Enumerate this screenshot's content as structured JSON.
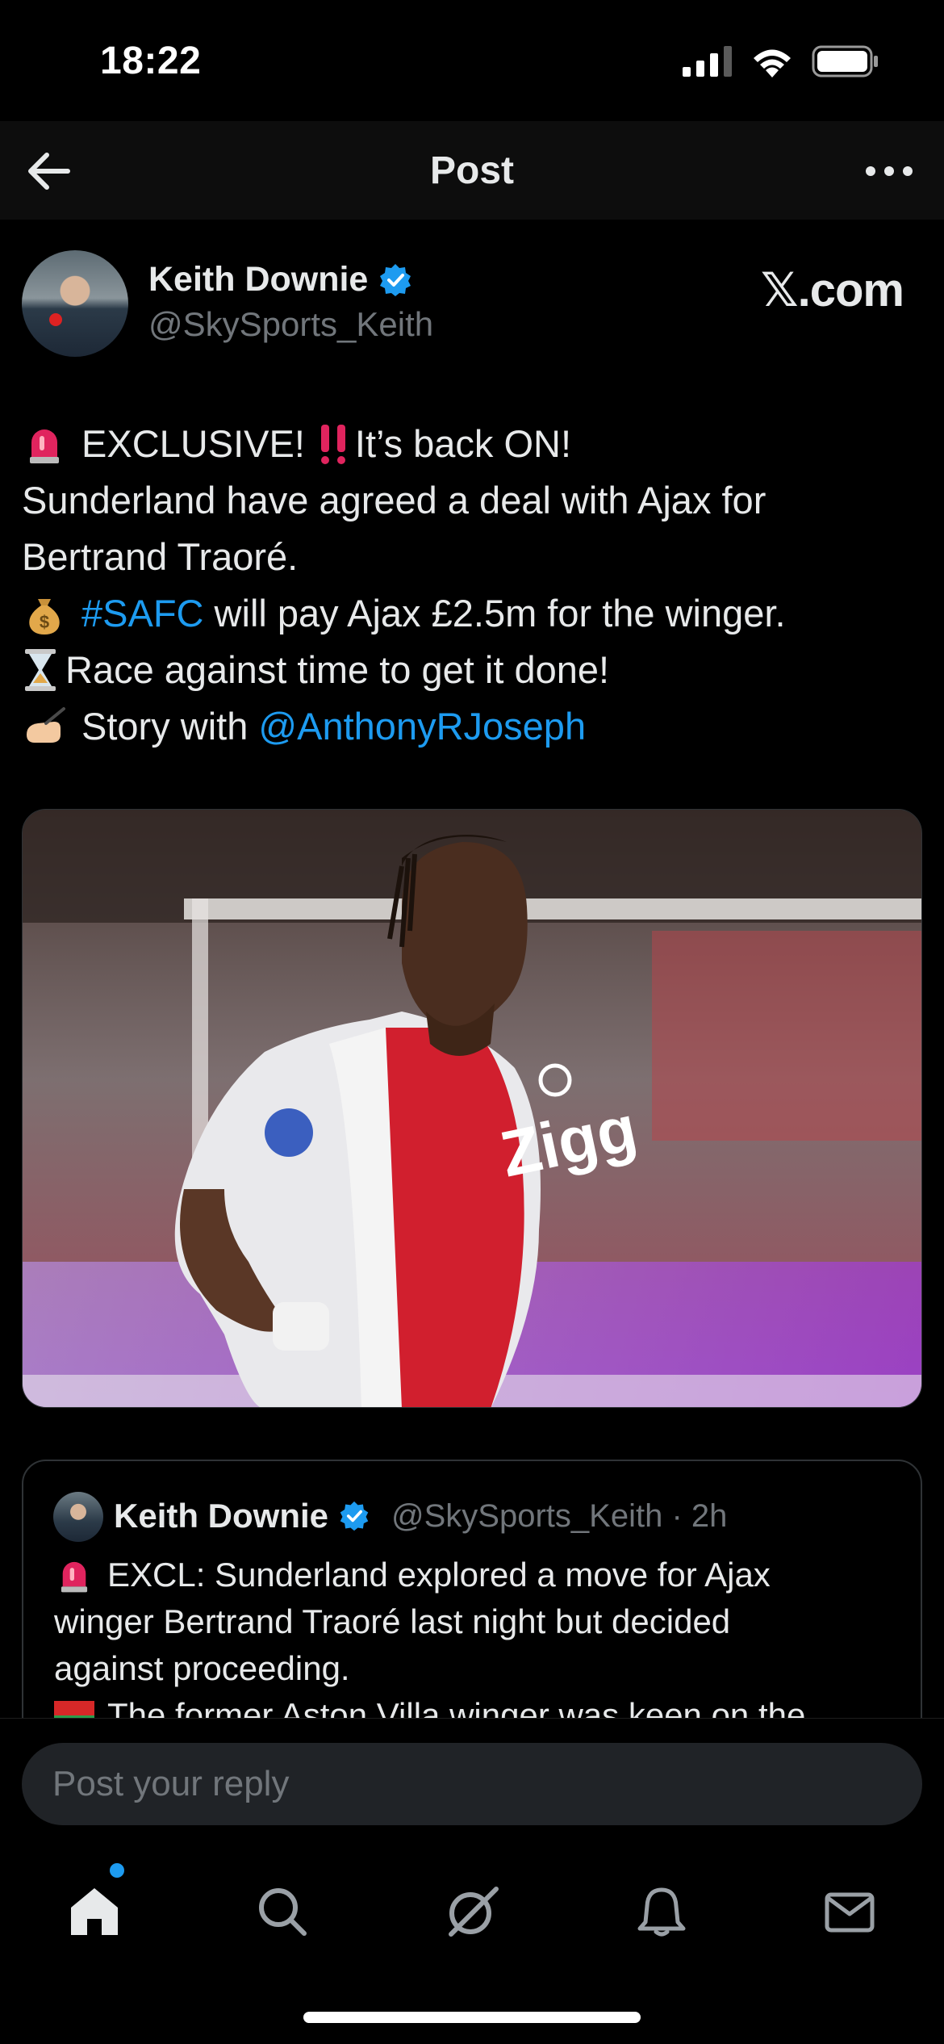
{
  "status_bar": {
    "time": "18:22",
    "icons": [
      "cellular-signal-icon",
      "wifi-icon",
      "battery-icon"
    ]
  },
  "header": {
    "title": "Post",
    "back_icon": "arrow-left-icon",
    "more_icon": "more-horizontal-icon"
  },
  "author": {
    "name": "Keith Downie",
    "handle": "@SkySports_Keith",
    "verified": true,
    "watermark": "𝕏.com"
  },
  "post": {
    "lines": [
      {
        "emoji": "rotating-light-icon",
        "text": "EXCLUSIVE!",
        "emoji2": "double-exclamation-icon",
        "text2": "It’s back ON!"
      },
      {
        "text": "Sunderland have agreed a deal with Ajax for"
      },
      {
        "text": "Bertrand Traoré."
      },
      {
        "emoji": "money-bag-icon",
        "hashtag": "#SAFC",
        "text": " will pay Ajax £2.5m for the winger."
      },
      {
        "emoji": "hourglass-icon",
        "text": "Race against time to get it done!"
      },
      {
        "emoji": "writing-hand-icon",
        "text": "Story with ",
        "mention": "@AnthonyRJoseph"
      }
    ],
    "image": "photo-of-ajax-player"
  },
  "quoted_post": {
    "name": "Keith Downie",
    "handle": "@SkySports_Keith",
    "time": "· 2h",
    "lines": [
      "EXCL: Sunderland explored a move for Ajax",
      "winger Bertrand Traoré last night but decided",
      "against proceeding.",
      "The former Aston Villa winger was keen on the"
    ]
  },
  "reply": {
    "placeholder": "Post your reply"
  },
  "tab_bar": {
    "items": [
      "home-icon",
      "search-icon",
      "grok-icon",
      "bell-icon",
      "mail-icon"
    ],
    "active": "home-icon",
    "home_has_notification": true
  },
  "colors": {
    "accent": "#1d9bf0",
    "background": "#000000",
    "text": "#e7e9ea",
    "secondary": "#71767b"
  }
}
